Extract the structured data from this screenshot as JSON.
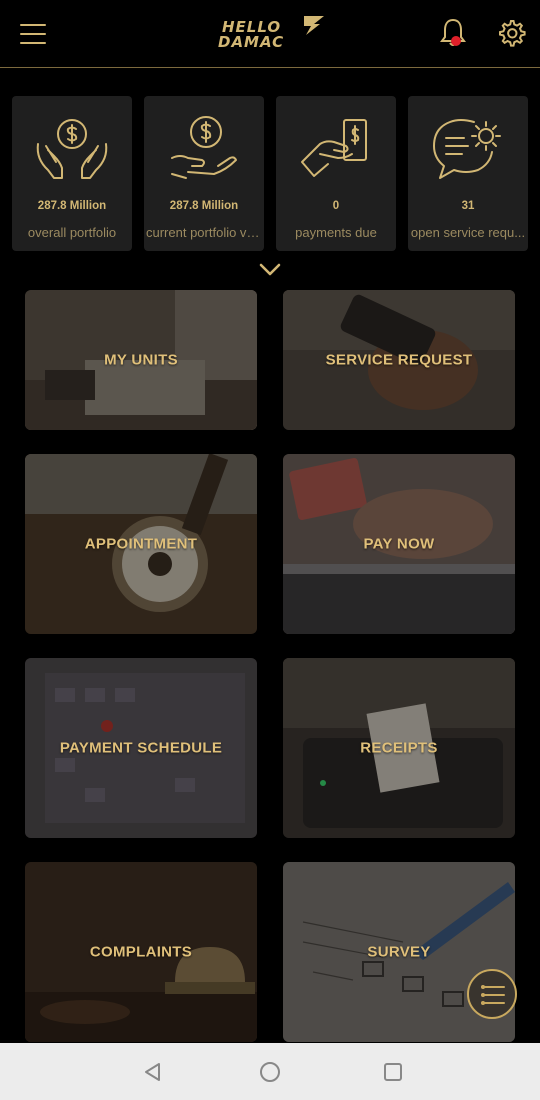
{
  "header": {
    "logo_line1": "HELLO",
    "logo_line2": "DAMAC"
  },
  "stats": [
    {
      "value": "287.8  Million",
      "label": "overall portfolio",
      "icon": "hands-dollar-icon"
    },
    {
      "value": "287.8  Million",
      "label": "current portfolio val...",
      "icon": "hand-dollar-coin-icon"
    },
    {
      "value": "0",
      "label": "payments due",
      "icon": "hand-bill-payment-icon"
    },
    {
      "value": "31",
      "label": "open service requ...",
      "icon": "chat-gear-icon"
    }
  ],
  "tiles": [
    {
      "label": "MY UNITS"
    },
    {
      "label": "SERVICE REQUEST"
    },
    {
      "label": "APPOINTMENT"
    },
    {
      "label": "PAY NOW"
    },
    {
      "label": "PAYMENT SCHEDULE"
    },
    {
      "label": "RECEIPTS"
    },
    {
      "label": "COMPLAINTS"
    },
    {
      "label": "SURVEY"
    }
  ],
  "colors": {
    "accent": "#d2b774",
    "background": "#000000",
    "card": "#1f1f1f",
    "notification_dot": "#e0202a"
  }
}
